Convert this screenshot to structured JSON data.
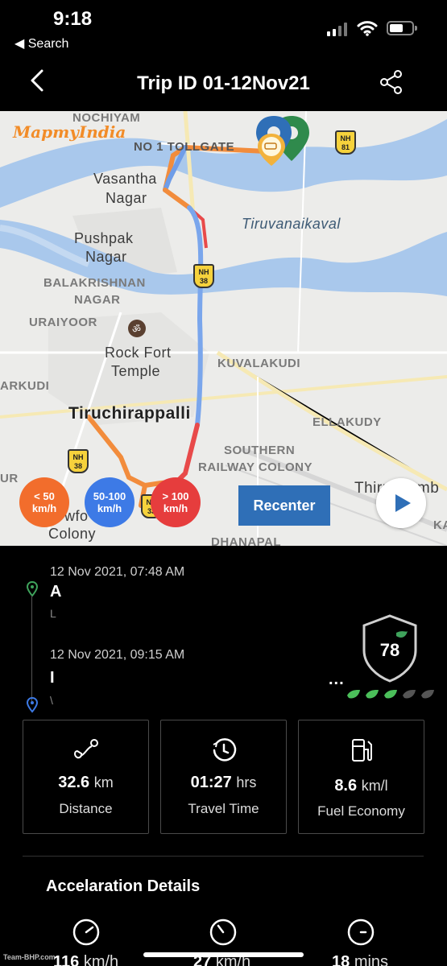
{
  "status_bar": {
    "time": "9:18",
    "back_app": "◀ Search"
  },
  "header": {
    "title": "Trip ID 01-12Nov21"
  },
  "map": {
    "brand": "MapmyIndia",
    "labels": {
      "nochiyam": "NOCHIYAM",
      "tollgate": "NO 1 TOLLGATE",
      "vasantha": "Vasantha",
      "vasantha2": "Nagar",
      "tiruvanaikaval": "Tiruvanaikaval",
      "pushpak": "Pushpak",
      "pushpak2": "Nagar",
      "balakrishnan": "BALAKRISHNAN",
      "balakrishnan2": "NAGAR",
      "uraiyoor": "URAIYOOR",
      "rockfort": "Rock Fort",
      "rockfort2": "Temple",
      "kuvalakudi": "KUVALAKUDI",
      "arkudi": "ARKUDI",
      "tiruchirappalli": "Tiruchirappalli",
      "ellakudy": "ELLAKUDY",
      "southern": "SOUTHERN",
      "railway": "RAILWAY COLONY",
      "ur": "UR",
      "thiru": "Thiruvaumb",
      "colony1": "wfo",
      "colony2": "Colony",
      "dhanapal": "DHANAPAL",
      "ka": "KA"
    },
    "nh": {
      "nh81": "NH 81",
      "nh38a": "NH 38",
      "nh38b": "NH 38",
      "nh33": "NH 33"
    },
    "speed_legend": [
      {
        "range": "< 50",
        "unit": "km/h"
      },
      {
        "range": "50-100",
        "unit": "km/h"
      },
      {
        "range": "> 100",
        "unit": "km/h"
      }
    ],
    "recenter_label": "Recenter"
  },
  "trip": {
    "start_time": "12 Nov 2021, 07:48 AM",
    "start_place": "A",
    "start_sub": "L",
    "end_time": "12 Nov 2021, 09:15 AM",
    "end_place": "I",
    "end_sub": "\\",
    "ellipsis": "...",
    "score": "78"
  },
  "stats": [
    {
      "value": "32.6",
      "unit": "km",
      "label": "Distance",
      "icon": "route-icon"
    },
    {
      "value": "01:27",
      "unit": "hrs",
      "label": "Travel Time",
      "icon": "clock-icon"
    },
    {
      "value": "8.6",
      "unit": "km/l",
      "label": "Fuel Economy",
      "icon": "fuel-pump-icon"
    }
  ],
  "acceleration": {
    "title": "Accelaration Details",
    "items": [
      {
        "value": "116",
        "unit": "km/h"
      },
      {
        "value": "27",
        "unit": "km/h"
      },
      {
        "value": "18",
        "unit": "mins"
      }
    ]
  },
  "watermark": "Team-BHP.com",
  "colors": {
    "accent": "#2f6fb7",
    "slow": "#f26d2c",
    "medium": "#3d7ae6",
    "fast": "#e63d3d",
    "river": "#a9c8ec"
  }
}
